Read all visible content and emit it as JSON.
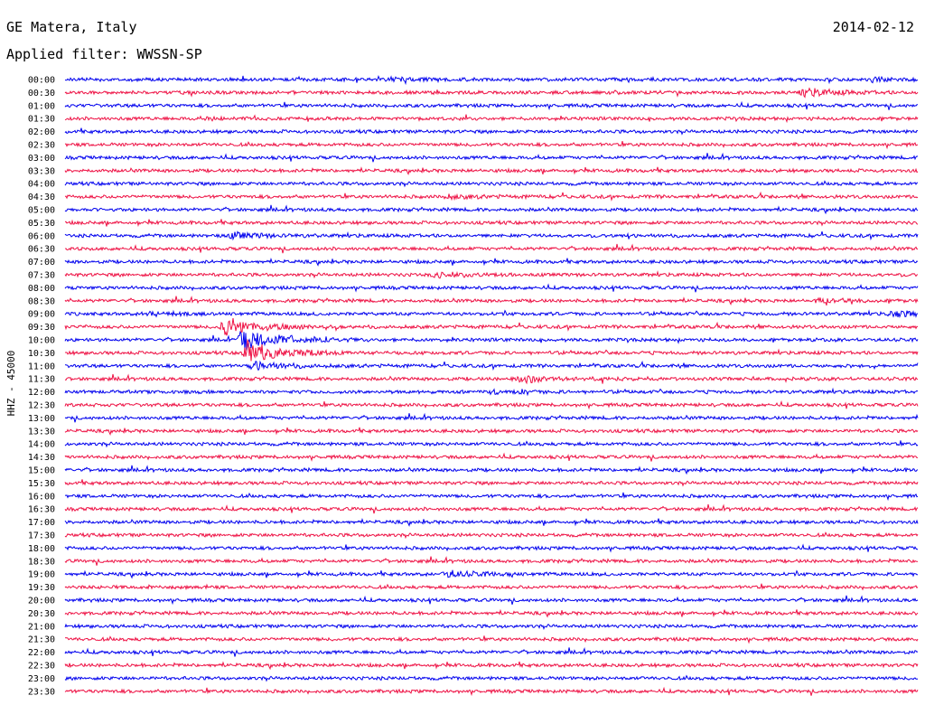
{
  "header": {
    "station": "GE Matera, Italy",
    "date": "2014-02-12",
    "filter": "Applied filter: WWSSN-SP"
  },
  "chart_data": {
    "type": "line",
    "title": "GE Matera, Italy",
    "date": "2014-02-12",
    "filter": "WWSSN-SP",
    "ylabel": "HHZ - 45000",
    "colors": [
      "#0000ee",
      "#ee1144"
    ],
    "trace_labels": [
      "00:00",
      "00:30",
      "01:00",
      "01:30",
      "02:00",
      "02:30",
      "03:00",
      "03:30",
      "04:00",
      "04:30",
      "05:00",
      "05:30",
      "06:00",
      "06:30",
      "07:00",
      "07:30",
      "08:00",
      "08:30",
      "09:00",
      "09:30",
      "10:00",
      "10:30",
      "11:00",
      "11:30",
      "12:00",
      "12:30",
      "13:00",
      "13:30",
      "14:00",
      "14:30",
      "15:00",
      "15:30",
      "16:00",
      "16:30",
      "17:00",
      "17:30",
      "18:00",
      "18:30",
      "19:00",
      "19:30",
      "20:00",
      "20:30",
      "21:00",
      "21:30",
      "22:00",
      "22:30",
      "23:00",
      "23:30"
    ],
    "events": [
      {
        "trace": 0,
        "minute": 11.5,
        "amplitude": 2.2
      },
      {
        "trace": 0,
        "minute": 28.3,
        "amplitude": 2.0
      },
      {
        "trace": 1,
        "minute": 26.0,
        "amplitude": 4.5
      },
      {
        "trace": 3,
        "minute": 5.0,
        "amplitude": 1.5
      },
      {
        "trace": 9,
        "minute": 13.5,
        "amplitude": 2.0
      },
      {
        "trace": 12,
        "minute": 5.9,
        "amplitude": 3.5
      },
      {
        "trace": 15,
        "minute": 13.0,
        "amplitude": 3.0
      },
      {
        "trace": 17,
        "minute": 26.5,
        "amplitude": 2.0
      },
      {
        "trace": 18,
        "minute": 2.9,
        "amplitude": 2.0
      },
      {
        "trace": 18,
        "minute": 29.2,
        "amplitude": 3.0
      },
      {
        "trace": 19,
        "minute": 5.6,
        "amplitude": 12.0
      },
      {
        "trace": 20,
        "minute": 6.2,
        "amplitude": 16.0
      },
      {
        "trace": 21,
        "minute": 6.4,
        "amplitude": 14.0
      },
      {
        "trace": 22,
        "minute": 6.6,
        "amplitude": 5.0
      },
      {
        "trace": 23,
        "minute": 15.9,
        "amplitude": 5.0
      },
      {
        "trace": 24,
        "minute": 15.0,
        "amplitude": 2.0
      },
      {
        "trace": 38,
        "minute": 13.4,
        "amplitude": 4.0
      }
    ]
  }
}
